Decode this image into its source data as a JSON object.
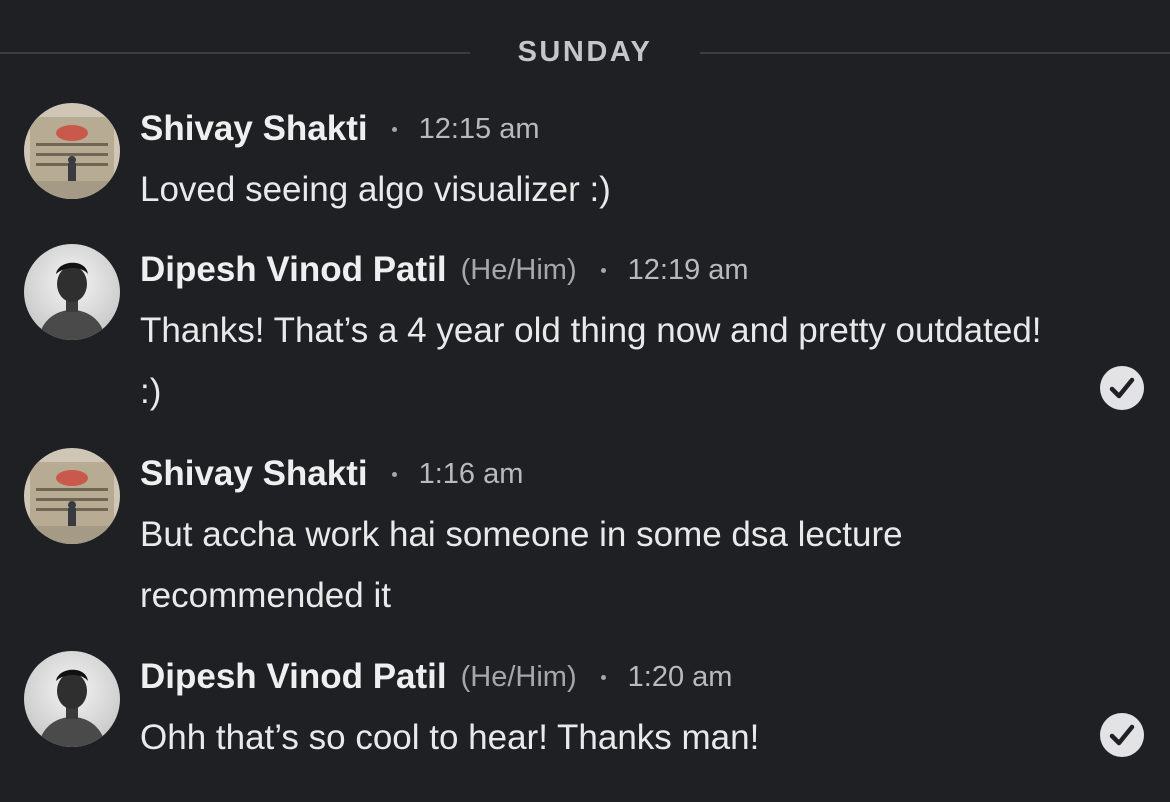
{
  "divider": {
    "label": "SUNDAY"
  },
  "messages": [
    {
      "sender": "Shivay Shakti",
      "pronouns": "",
      "time": "12:15 am",
      "text": "Loved seeing algo visualizer :)",
      "read_receipt": false
    },
    {
      "sender": "Dipesh Vinod Patil",
      "pronouns": "(He/Him)",
      "time": "12:19 am",
      "text": "Thanks! That’s a 4 year old thing now and pretty outdated! :)",
      "read_receipt": true
    },
    {
      "sender": "Shivay Shakti",
      "pronouns": "",
      "time": "1:16 am",
      "text": "But accha work hai someone in some dsa lecture recommended it",
      "read_receipt": false
    },
    {
      "sender": "Dipesh Vinod Patil",
      "pronouns": "(He/Him)",
      "time": "1:20 am",
      "text": "Ohh that’s so cool to hear! Thanks man!",
      "read_receipt": true
    }
  ],
  "colors": {
    "background": "#1e2024",
    "text": "#e9e9ea",
    "muted": "#a6a7ab",
    "check_fill": "#e3e3e5"
  }
}
